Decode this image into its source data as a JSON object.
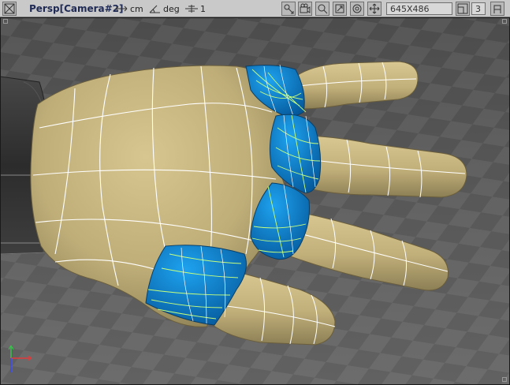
{
  "toolbar": {
    "view_title": "Persp[Camera#2]",
    "units_label": "cm",
    "angle_label": "deg",
    "snap_value": "1",
    "resolution": "645X486",
    "layout_number": "3"
  },
  "icons": {
    "menu": "viewport-menu-icon",
    "units": "horizontal-arrows-icon",
    "angle": "angle-icon",
    "snap": "snap-grid-icon",
    "camera_tools": [
      "move-camera-icon",
      "film-camera-icon",
      "zoom-icon",
      "orbit-icon",
      "fit-view-icon",
      "pan-icon"
    ],
    "layout": "layout-split-icon",
    "maximize": "maximize-icon"
  },
  "colors": {
    "hand_surface": "#c9b77e",
    "selected_patch": "#0a7fc4",
    "wire_highlight": "#c8ff7a",
    "wire": "#ffffff",
    "toolbar_bg": "#c9c9c9",
    "axis_x": "#e23a3a",
    "axis_y": "#37c24a",
    "axis_z": "#3a4cff"
  }
}
